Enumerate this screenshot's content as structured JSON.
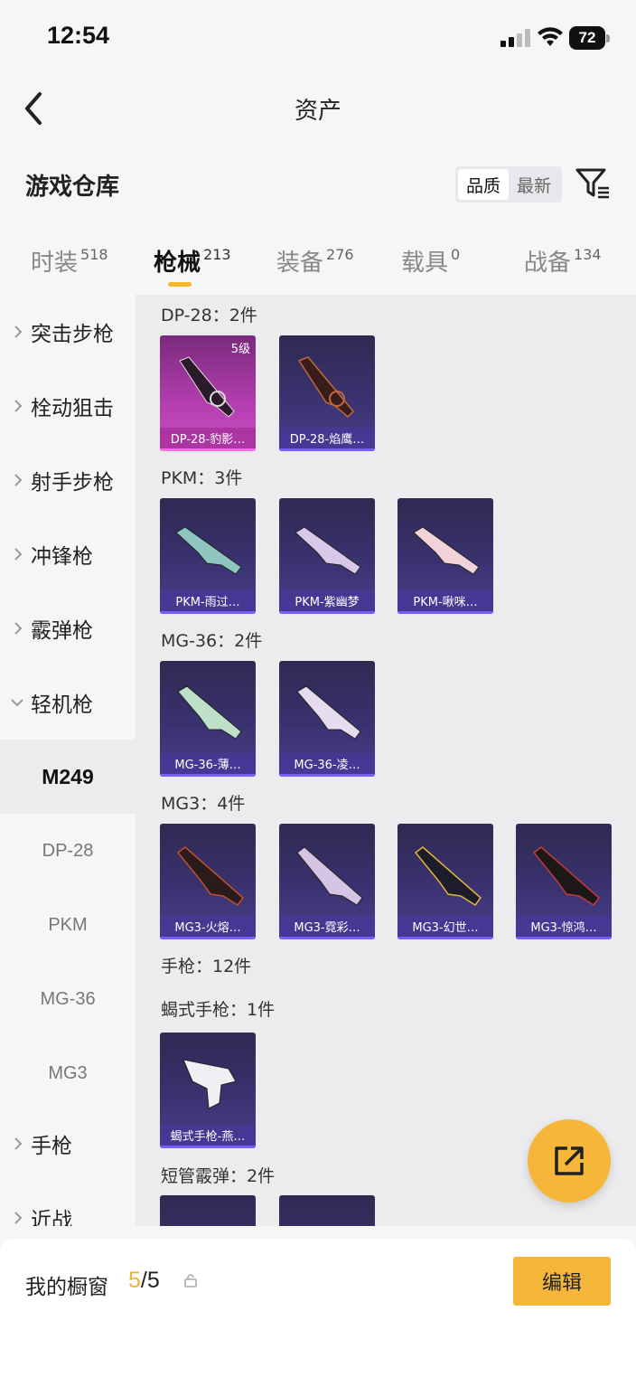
{
  "status_bar": {
    "time": "12:54",
    "battery": "72"
  },
  "header": {
    "title": "资产",
    "back_icon": "back-chevron-icon"
  },
  "warehouse": {
    "title": "游戏仓库",
    "sort_options": [
      "品质",
      "最新"
    ],
    "filter_icon": "filter-icon"
  },
  "tabs": [
    {
      "label": "时装",
      "count": "518"
    },
    {
      "label": "枪械",
      "count": "213"
    },
    {
      "label": "装备",
      "count": "276"
    },
    {
      "label": "载具",
      "count": "0"
    },
    {
      "label": "战备",
      "count": "134"
    }
  ],
  "sidebar": {
    "items": [
      "突击步枪",
      "栓动狙击",
      "射手步枪",
      "冲锋枪",
      "霰弹枪",
      "轻机枪"
    ],
    "subitems": [
      "M249",
      "DP-28",
      "PKM",
      "MG-36",
      "MG3"
    ],
    "items_after": [
      "手枪",
      "近战"
    ]
  },
  "groups": [
    {
      "title": "DP-28：2件",
      "cards": [
        {
          "name": "DP-28-豹影…",
          "badge": "5级"
        },
        {
          "name": "DP-28-焰鹰…"
        }
      ]
    },
    {
      "title": "PKM：3件",
      "cards": [
        {
          "name": "PKM-雨过…"
        },
        {
          "name": "PKM-紫幽梦"
        },
        {
          "name": "PKM-啾咪…"
        }
      ]
    },
    {
      "title": "MG-36：2件",
      "cards": [
        {
          "name": "MG-36-薄…"
        },
        {
          "name": "MG-36-凌…"
        }
      ]
    },
    {
      "title": "MG3：4件",
      "cards": [
        {
          "name": "MG3-火熔…"
        },
        {
          "name": "MG3-霓彩…"
        },
        {
          "name": "MG3-幻世…"
        },
        {
          "name": "MG3-惊鸿…"
        }
      ]
    },
    {
      "title": "手枪：12件"
    },
    {
      "title": "蝎式手枪：1件",
      "cards": [
        {
          "name": "蝎式手枪-燕…"
        }
      ]
    },
    {
      "title": "短管霰弹：2件"
    }
  ],
  "bottom": {
    "label": "我的橱窗",
    "count_current": "5",
    "count_total": "/5",
    "edit_label": "编辑"
  },
  "colors": {
    "accent": "#f5b63a",
    "card_purple": "#3a3270",
    "card_pink": "#b43eb0"
  }
}
